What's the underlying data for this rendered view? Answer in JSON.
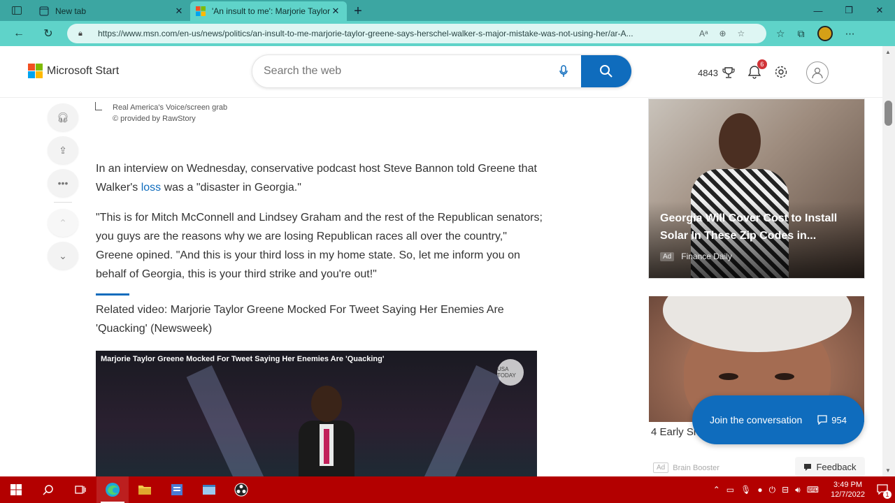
{
  "browser": {
    "tabs": [
      {
        "title": "New tab",
        "active": false
      },
      {
        "title": "'An insult to me': Marjorie Taylor",
        "active": true
      }
    ],
    "url": "https://www.msn.com/en-us/news/politics/an-insult-to-me-marjorie-taylor-greene-says-herschel-walker-s-major-mistake-was-not-using-her/ar-A..."
  },
  "header": {
    "brand": "Microsoft Start",
    "search_placeholder": "Search the web",
    "points": "4843",
    "notification_count": "6"
  },
  "article": {
    "credit_line1": "Real America's Voice/screen grab",
    "credit_line2": "© provided by RawStory",
    "p1_before": "In an interview on Wednesday, conservative podcast host Steve Bannon told Greene that Walker's ",
    "p1_link": "loss",
    "p1_after": " was a \"disaster in Georgia.\"",
    "p2": "\"This is for Mitch McConnell and Lindsey Graham and the rest of the Republican senators; you guys are the reasons why we are losing Republican races all over the country,\" Greene opined. \"And this is your third loss in my home state. So, let me inform you on behalf of Georgia, this is your third strike and you're out!\"",
    "related": "Related video: Marjorie Taylor Greene Mocked For Tweet Saying Her Enemies Are 'Quacking' (Newsweek)",
    "video_title": "Marjorie Taylor Greene Mocked For Tweet Saying Her Enemies Are 'Quacking'",
    "video_logo": "USA TODAY"
  },
  "ads": {
    "ad1_title": "Georgia Will Cover Cost to Install Solar In These Zip Codes in...",
    "ad1_tag": "Ad",
    "ad1_source": "Finance Daily",
    "ad2_caption": "4 Early Si",
    "ad2_tag": "Ad",
    "ad2_source": "Brain Booster"
  },
  "conversation": {
    "label": "Join the conversation",
    "count": "954"
  },
  "feedback_label": "Feedback",
  "taskbar": {
    "time": "3:49 PM",
    "date": "12/7/2022",
    "notif": "1"
  },
  "colors": {
    "accent": "#0f6cbd",
    "taskbar": "#b30000",
    "tabstrip": "#3ca6a2",
    "toolbar": "#5fd3c9"
  }
}
